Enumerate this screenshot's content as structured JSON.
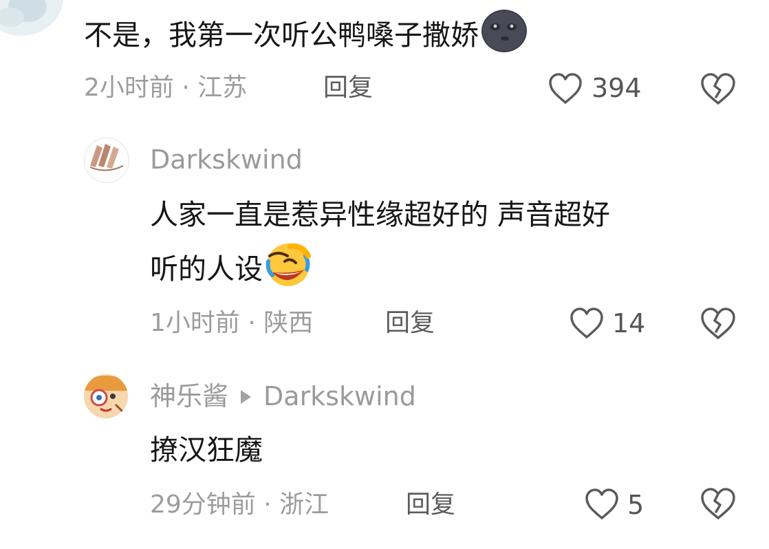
{
  "comments": [
    {
      "text": "不是，我第一次听公鸭嗓子撒娇",
      "time": "2小时前 · 江苏",
      "reply": "回复",
      "likes": "394"
    },
    {
      "user": "Darkskwind",
      "text_line1": "人家一直是惹异性缘超好的 声音超好",
      "text_line2": "听的人设",
      "time": "1小时前 · 陕西",
      "reply": "回复",
      "likes": "14"
    },
    {
      "user": "神乐酱",
      "reply_to": "Darkskwind",
      "text": "撩汉狂魔",
      "time": "29分钟前 · 浙江",
      "reply": "回复",
      "likes": "5"
    }
  ],
  "icons": {
    "like": "heart-outline-icon",
    "dislike": "broken-heart-icon",
    "emoji1": "new-moon-face-emoji",
    "emoji2": "rolling-laughing-emoji"
  },
  "colors": {
    "text": "#161616",
    "meta": "#9c9c9c",
    "username": "#9a9a9a"
  }
}
